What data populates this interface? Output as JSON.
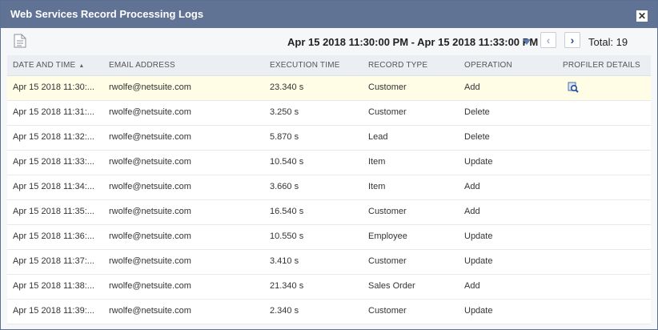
{
  "dialog": {
    "title": "Web Services Record Processing Logs",
    "close_label": "✕"
  },
  "toolbar": {
    "range": "Apr 15 2018 11:30:00 PM - Apr 15 2018 11:33:00 PM",
    "total": "Total: 19",
    "prev_label": "‹",
    "next_label": "›"
  },
  "table": {
    "headers": {
      "date": "DATE AND TIME",
      "email": "EMAIL ADDRESS",
      "exec": "EXECUTION TIME",
      "type": "RECORD TYPE",
      "op": "OPERATION",
      "prof": "PROFILER DETAILS"
    },
    "rows": [
      {
        "date": "Apr 15 2018 11:30:...",
        "email": "rwolfe@netsuite.com",
        "exec": "23.340 s",
        "type": "Customer",
        "op": "Add"
      },
      {
        "date": "Apr 15 2018 11:31:...",
        "email": "rwolfe@netsuite.com",
        "exec": "3.250 s",
        "type": "Customer",
        "op": "Delete"
      },
      {
        "date": "Apr 15 2018 11:32:...",
        "email": "rwolfe@netsuite.com",
        "exec": "5.870 s",
        "type": "Lead",
        "op": "Delete"
      },
      {
        "date": "Apr 15 2018 11:33:...",
        "email": "rwolfe@netsuite.com",
        "exec": "10.540 s",
        "type": "Item",
        "op": "Update"
      },
      {
        "date": "Apr 15 2018 11:34:...",
        "email": "rwolfe@netsuite.com",
        "exec": "3.660 s",
        "type": "Item",
        "op": "Add"
      },
      {
        "date": "Apr 15 2018 11:35:...",
        "email": "rwolfe@netsuite.com",
        "exec": "16.540 s",
        "type": "Customer",
        "op": "Add"
      },
      {
        "date": "Apr 15 2018 11:36:...",
        "email": "rwolfe@netsuite.com",
        "exec": "10.550 s",
        "type": "Employee",
        "op": "Update"
      },
      {
        "date": "Apr 15 2018 11:37:...",
        "email": "rwolfe@netsuite.com",
        "exec": "3.410 s",
        "type": "Customer",
        "op": "Update"
      },
      {
        "date": "Apr 15 2018 11:38:...",
        "email": "rwolfe@netsuite.com",
        "exec": "21.340 s",
        "type": "Sales Order",
        "op": "Add"
      },
      {
        "date": "Apr 15 2018 11:39:...",
        "email": "rwolfe@netsuite.com",
        "exec": "2.340 s",
        "type": "Customer",
        "op": "Update"
      }
    ]
  },
  "colors": {
    "titlebar": "#607394",
    "selected_row": "#fffde6",
    "accent": "#2b4d86"
  }
}
